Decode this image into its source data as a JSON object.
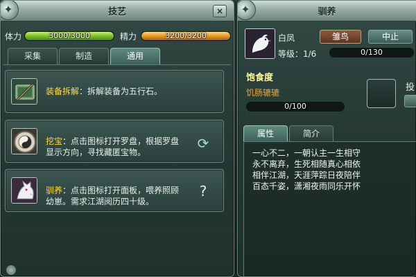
{
  "left_window": {
    "title": "技艺",
    "close_label": "×",
    "stats": {
      "stamina": {
        "label": "体力",
        "text": "3000/3000",
        "fraction": 1.0,
        "color": "#7fbf2a"
      },
      "energy": {
        "label": "精力",
        "text": "3200/3200",
        "fraction": 1.0,
        "color": "#e79a2a"
      }
    },
    "tabs": [
      {
        "label": "采集",
        "active": false
      },
      {
        "label": "制造",
        "active": false
      },
      {
        "label": "通用",
        "active": true
      }
    ],
    "skills": [
      {
        "title": "装备拆解",
        "description": "：拆解装备为五行石。",
        "icon": "equipment-scroll-icon",
        "action_icon": ""
      },
      {
        "title": "挖宝",
        "description": "：点击图标打开罗盘，根据罗盘显示方向，寻找藏匿宝物。",
        "icon": "compass-icon",
        "action_icon": "refresh-icon",
        "action_glyph": "⟳"
      },
      {
        "title": "驯养",
        "description": "：点击图标打开面板，喂养照顾幼崽。需求江湖阅历四十级。",
        "icon": "white-wolf-icon",
        "action_icon": "question-icon",
        "action_glyph": "?"
      }
    ]
  },
  "right_window": {
    "title": "驯养",
    "pet": {
      "name": "白凤",
      "stage_label": "雏鸟",
      "stop_label": "中止",
      "level_label": "等级：1/6",
      "exp_text": "0/130",
      "exp_fraction": 0
    },
    "hunger": {
      "label": "饱食度",
      "status": "饥肠辘辘",
      "text": "0/100",
      "fraction": 0
    },
    "feed_label": "投",
    "tabs": [
      {
        "label": "属性",
        "active": true
      },
      {
        "label": "简介",
        "active": false
      }
    ],
    "poem": "一心不二，一朝认主一生相守\n永不离弃，生死相随真心相依\n相伴江湖，天涯萍踪日夜陪伴\n百态千姿，潇湘夜雨同乐开怀"
  },
  "colors": {
    "title_yellow": "#ffd94a",
    "hunger_status": "#e3a33b",
    "panel_bg": "#263935"
  }
}
